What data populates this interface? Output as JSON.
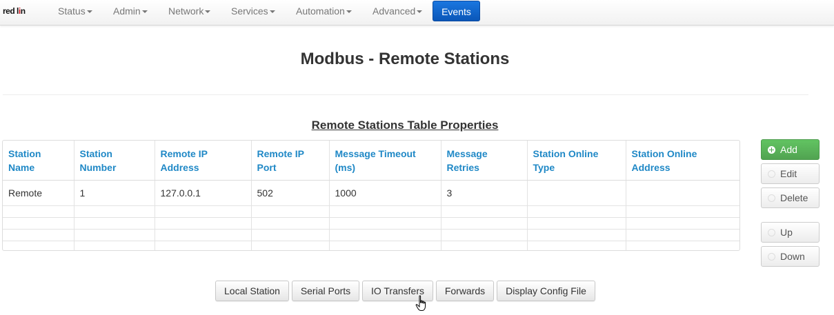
{
  "brand": {
    "text_pre": "red l",
    "text_mark": "i",
    "text_post": "n"
  },
  "navbar": {
    "items": [
      {
        "label": "Status"
      },
      {
        "label": "Admin"
      },
      {
        "label": "Network"
      },
      {
        "label": "Services"
      },
      {
        "label": "Automation"
      },
      {
        "label": "Advanced"
      }
    ],
    "active": {
      "label": "Events"
    }
  },
  "page_title": "Modbus - Remote Stations",
  "section_title": "Remote Stations Table Properties",
  "table": {
    "headers": [
      {
        "line1": "Station",
        "line2": "Name"
      },
      {
        "line1": "Station",
        "line2": "Number"
      },
      {
        "line1": "Remote IP",
        "line2": "Address"
      },
      {
        "line1": "Remote IP",
        "line2": "Port"
      },
      {
        "line1": "Message Timeout",
        "line2": "(ms)"
      },
      {
        "line1": "Message",
        "line2": "Retries"
      },
      {
        "line1": "Station Online",
        "line2": "Type"
      },
      {
        "line1": "Station Online",
        "line2": "Address"
      }
    ],
    "rows": [
      [
        "Remote",
        "1",
        "127.0.0.1",
        "502",
        "1000",
        "3",
        "",
        ""
      ]
    ]
  },
  "side_buttons": {
    "add": "Add",
    "edit": "Edit",
    "delete": "Delete",
    "up": "Up",
    "down": "Down"
  },
  "bottom_buttons": {
    "local_station": "Local Station",
    "serial_ports": "Serial Ports",
    "io_transfers": "IO Transfers",
    "forwards": "Forwards",
    "display_config": "Display Config File"
  },
  "colors": {
    "accent": "#1f88c6",
    "active_nav": "#0a56b8",
    "add_button": "#51a351",
    "brand_mark": "#d9141c"
  }
}
